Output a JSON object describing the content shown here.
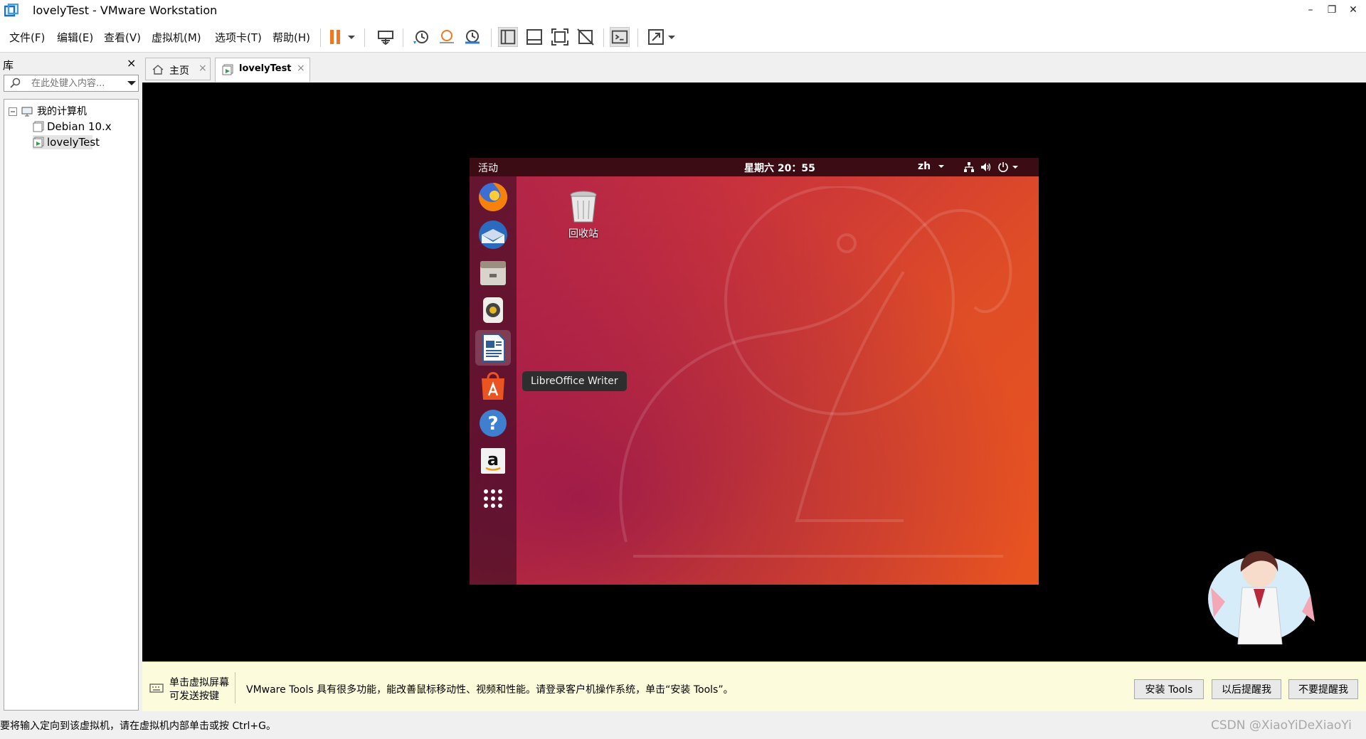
{
  "window": {
    "title": "lovelyTest - VMware Workstation",
    "controls": {
      "minimize": "–",
      "restore": "❐",
      "close": "✕"
    }
  },
  "menu": {
    "items": [
      "文件(F)",
      "编辑(E)",
      "查看(V)",
      "虚拟机(M)",
      "选项卡(T)",
      "帮助(H)"
    ]
  },
  "toolbar": {
    "icons": [
      "pause-icon",
      "send-ctrl-alt-del-icon",
      "snapshot-icon",
      "revert-snapshot-icon",
      "snapshot-manager-icon",
      "library-view-icon",
      "thumbnail-bar-icon",
      "fullscreen-icon",
      "unity-icon",
      "console-icon",
      "stretch-icon"
    ],
    "pause_color": "#f07822"
  },
  "library": {
    "title": "库",
    "close": "×",
    "search_placeholder": "在此处键入内容...",
    "tree": {
      "root": "我的计算机",
      "items": [
        "Debian 10.x",
        "lovelyTest"
      ]
    }
  },
  "tabs": [
    {
      "label": "主页",
      "close": "×"
    },
    {
      "label": "lovelyTest",
      "close": "×"
    }
  ],
  "guest": {
    "activities": "活动",
    "clock": "星期六 20：55",
    "lang": "zh",
    "dock_tooltip": "LibreOffice Writer",
    "trash_label": "回收站",
    "dock_icons": [
      "firefox-icon",
      "thunderbird-icon",
      "files-icon",
      "rhythmbox-icon",
      "libreoffice-writer-icon",
      "software-center-icon",
      "help-icon",
      "amazon-icon",
      "app-grid-icon"
    ],
    "brand_orange": "#e95420",
    "brand_purple": "#77216f"
  },
  "notification": {
    "line1": "单击虚拟屏幕",
    "line2": "可发送按键",
    "message": "VMware Tools 具有很多功能，能改善鼠标移动性、视频和性能。请登录客户机操作系统，单击“安装 Tools”。",
    "buttons": [
      "安装 Tools",
      "以后提醒我",
      "不要提醒我"
    ]
  },
  "status": {
    "text": "要将输入定向到该虚拟机，请在虚拟机内部单击或按 Ctrl+G。",
    "watermark": "CSDN @XiaoYiDeXiaoYi"
  }
}
